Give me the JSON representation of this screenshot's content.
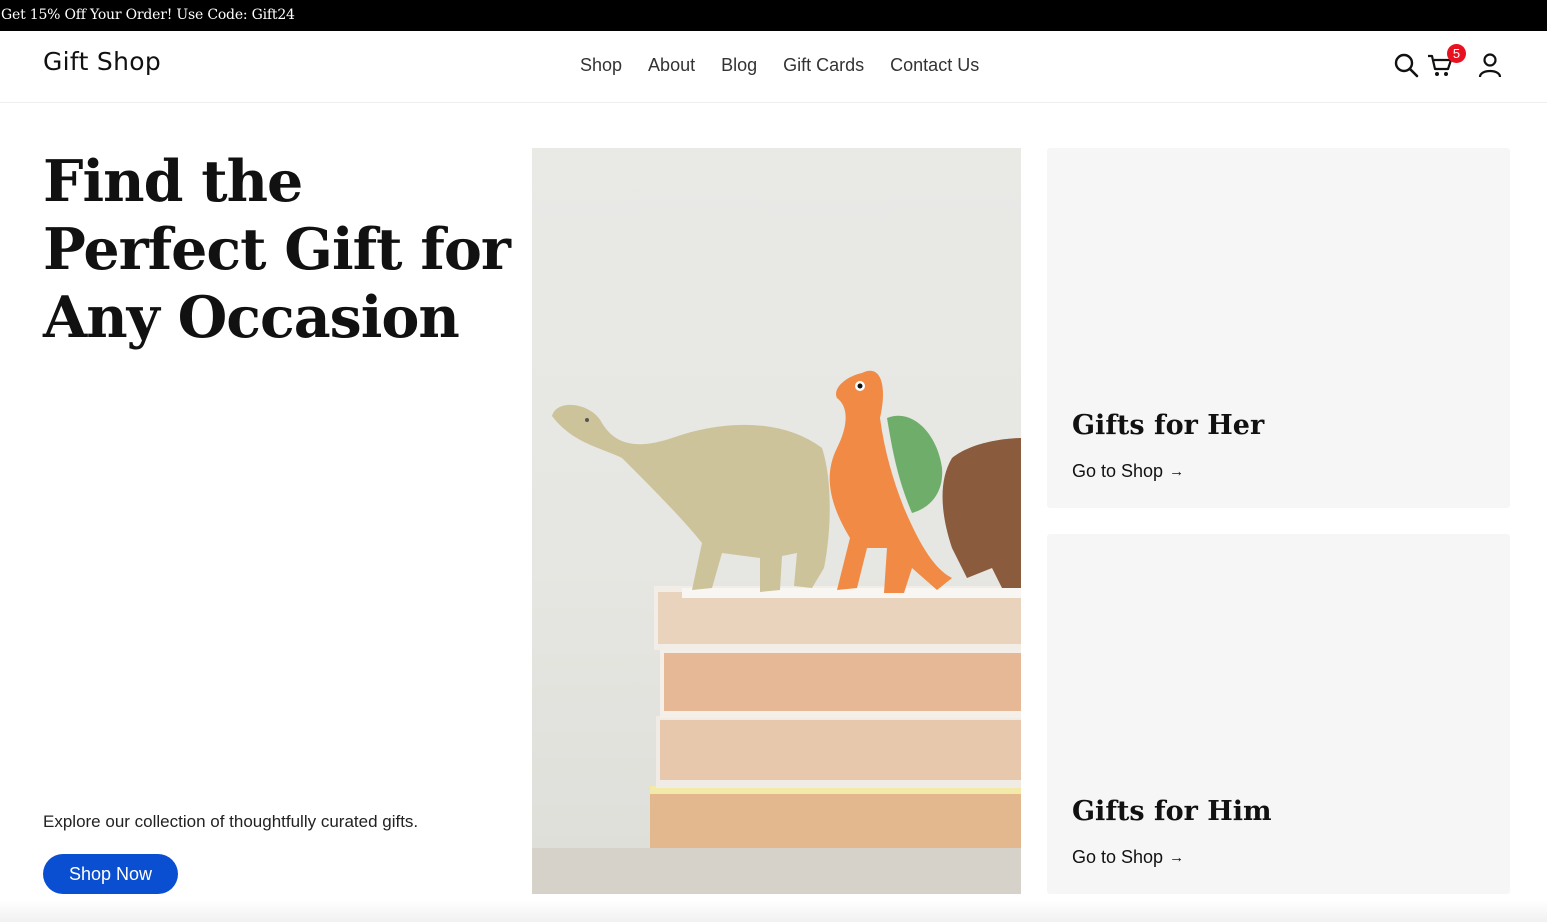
{
  "promo": {
    "text": "Get 15% Off Your Order! Use Code: Gift24"
  },
  "header": {
    "logo": "Gift Shop",
    "nav": [
      {
        "label": "Shop"
      },
      {
        "label": "About"
      },
      {
        "label": "Blog"
      },
      {
        "label": "Gift Cards"
      },
      {
        "label": "Contact Us"
      }
    ],
    "icons": {
      "search": "search-icon",
      "cart": "cart-icon",
      "account": "user-icon"
    },
    "cart_count": "5"
  },
  "hero": {
    "title": "Find the Perfect Gift for Any Occasion",
    "description": "Explore our collection of thoughtfully curated gifts.",
    "cta_label": "Shop Now"
  },
  "categories": [
    {
      "title": "Gifts for Her",
      "link_label": "Go to Shop",
      "arrow": "→"
    },
    {
      "title": "Gifts for Him",
      "link_label": "Go to Shop",
      "arrow": "→"
    }
  ],
  "colors": {
    "promo_bg": "#000000",
    "accent": "#0a4fd1",
    "badge": "#e8111f",
    "card_bg": "#f6f6f6"
  }
}
